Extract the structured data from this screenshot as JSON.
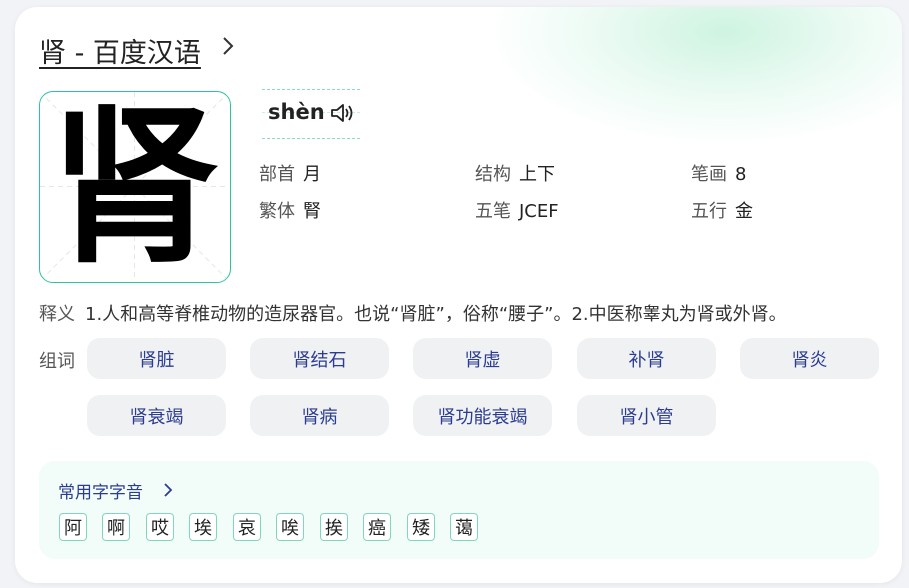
{
  "header": {
    "title": "肾 - 百度汉语"
  },
  "character": {
    "glyph": "肾",
    "pinyin": "shèn",
    "speaker_icon": "speaker-icon"
  },
  "attributes": {
    "radical_key": "部首",
    "radical_val": "月",
    "structure_key": "结构",
    "structure_val": "上下",
    "strokes_key": "笔画",
    "strokes_val": "8",
    "traditional_key": "繁体",
    "traditional_val": "腎",
    "wubi_key": "五笔",
    "wubi_val": "JCEF",
    "wuxing_key": "五行",
    "wuxing_val": "金"
  },
  "definition": {
    "label": "释义",
    "text": "1.人和高等脊椎动物的造尿器官。也说“肾脏”，俗称“腰子”。2.中医称睾丸为肾或外肾。"
  },
  "words": {
    "label": "组词",
    "items": [
      "肾脏",
      "肾结石",
      "肾虚",
      "补肾",
      "肾炎",
      "肾衰竭",
      "肾病",
      "肾功能衰竭",
      "肾小管"
    ]
  },
  "common": {
    "title": "常用字字音",
    "chars": [
      "阿",
      "啊",
      "哎",
      "埃",
      "哀",
      "唉",
      "挨",
      "癌",
      "矮",
      "蔼"
    ]
  },
  "colors": {
    "accent": "#2ec3a0",
    "link": "#2c3d91",
    "chip_bg": "#f0f1f3"
  }
}
